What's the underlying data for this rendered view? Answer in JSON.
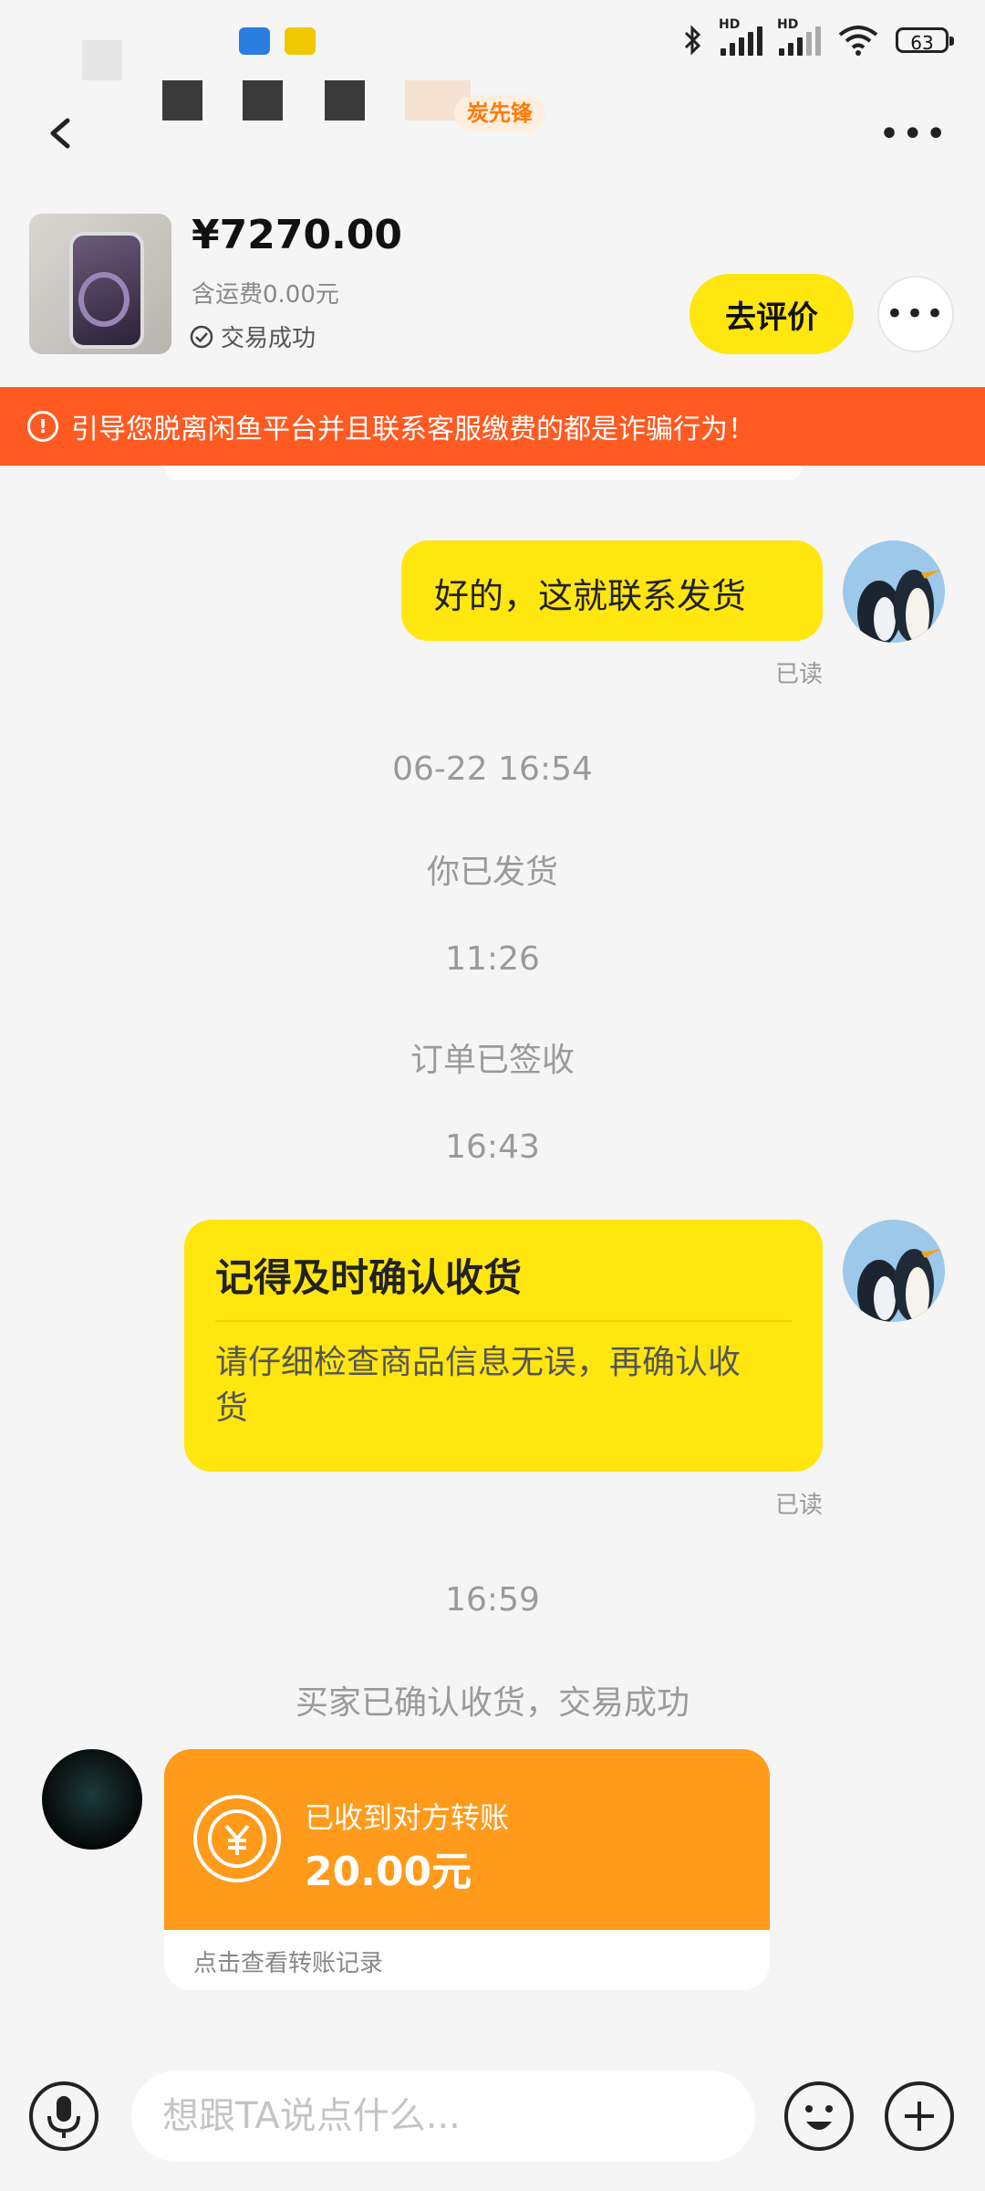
{
  "status_bar": {
    "hd_label": "HD",
    "battery": "63"
  },
  "header": {
    "badge_text": "炭先锋",
    "more_label": "•••"
  },
  "product": {
    "price": "¥7270.00",
    "shipping": "含运费0.00元",
    "status": "交易成功",
    "review_button": "去评价",
    "more_label": "•••"
  },
  "warning": {
    "icon": "!",
    "text": "引导您脱离闲鱼平台并且联系客服缴费的都是诈骗行为！"
  },
  "messages": {
    "reply_text": "好的，这就联系发货",
    "read_label": "已读",
    "time1": "06-22 16:54",
    "shipped": "你已发货",
    "time2": "11:26",
    "signed": "订单已签收",
    "time3": "16:43",
    "confirm_title": "记得及时确认收货",
    "confirm_body": "请仔细检查商品信息无误，再确认收货",
    "time4": "16:59",
    "buyer_confirmed": "买家已确认收货，交易成功"
  },
  "transfer": {
    "label": "已收到对方转账",
    "amount": "20.00元",
    "link": "点击查看转账记录"
  },
  "input_bar": {
    "placeholder": "想跟TA说点什么..."
  },
  "colors": {
    "accent_yellow": "#ffe60f",
    "warning_orange": "#ff5a22",
    "transfer_orange": "#ff9a1a"
  }
}
